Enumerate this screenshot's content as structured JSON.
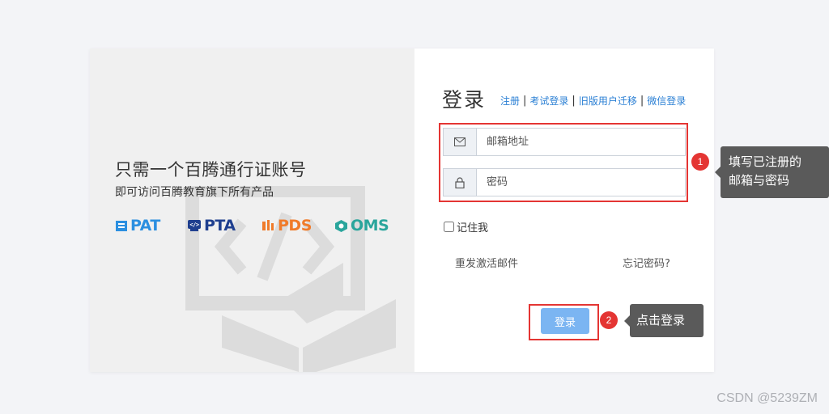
{
  "left": {
    "tagline": "只需一个百腾通行证账号",
    "subtagline": "即可访问百腾教育旗下所有产品",
    "brands": [
      {
        "label": "PAT",
        "color": "#2b8fe0",
        "icon": "pat-logo-icon"
      },
      {
        "label": "PTA",
        "color": "#1f3f8f",
        "icon": "pta-logo-icon"
      },
      {
        "label": "PDS",
        "color": "#f07b2a",
        "icon": "pds-logo-icon"
      },
      {
        "label": "OMS",
        "color": "#2aa59c",
        "icon": "oms-logo-icon"
      }
    ]
  },
  "login": {
    "title": "登录",
    "links": [
      "注册",
      "考试登录",
      "旧版用户迁移",
      "微信登录"
    ],
    "email_placeholder": "邮箱地址",
    "password_placeholder": "密码",
    "email_icon": "envelope-icon",
    "password_icon": "lock-icon",
    "remember_label": "记住我",
    "resend_label": "重发激活邮件",
    "forgot_label": "忘记密码?",
    "submit_label": "登录"
  },
  "annotations": [
    {
      "number": "1",
      "line1": "填写已注册的",
      "line2": "邮箱与密码"
    },
    {
      "number": "2",
      "text": "点击登录"
    }
  ],
  "watermark": "CSDN @5239ZM",
  "colors": {
    "accent_red": "#e43533",
    "link_blue": "#2a7fd4",
    "button_blue": "#7bb5f2",
    "tooltip_gray": "#5a5a5a"
  }
}
